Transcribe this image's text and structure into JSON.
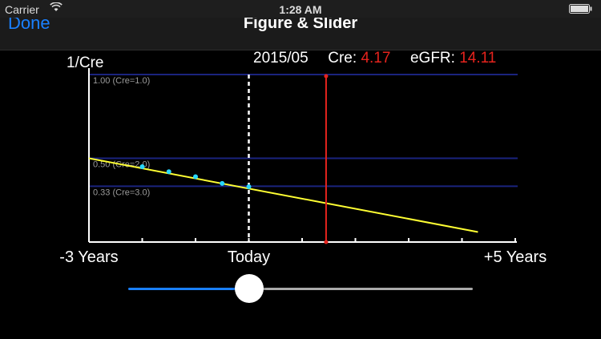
{
  "status_bar": {
    "carrier": "Carrier",
    "time": "1:28 AM"
  },
  "nav": {
    "back_label": "Done",
    "title": "Figure & Slider"
  },
  "readout": {
    "date": "2015/05",
    "cre_label": "Cre:",
    "cre_value": "4.17",
    "egfr_label": "eGFR:",
    "egfr_value": "14.11"
  },
  "slider": {
    "value": 0.35,
    "min_color": "#1a80ff",
    "max_color": "#aaaaaa"
  },
  "chart_data": {
    "type": "line",
    "ylabel": "1/Cre",
    "xlim": [
      -3,
      5
    ],
    "ylim": [
      0,
      1.0
    ],
    "x_tick_labels": [
      {
        "x": -3,
        "label": "-3 Years"
      },
      {
        "x": 0,
        "label": "Today"
      },
      {
        "x": 5,
        "label": "+5 Years"
      }
    ],
    "x_ticks": [
      -3,
      -2,
      -1,
      0,
      1,
      2,
      3,
      4,
      5
    ],
    "reference_lines": [
      {
        "y": 1.0,
        "label": "1.00 (Cre=1.0)"
      },
      {
        "y": 0.5,
        "label": "0.50 (Cre=2.0)"
      },
      {
        "y": 0.333,
        "label": "0.33 (Cre=3.0)"
      }
    ],
    "points": [
      {
        "x": -2.0,
        "y": 0.45
      },
      {
        "x": -1.5,
        "y": 0.42
      },
      {
        "x": -1.0,
        "y": 0.39
      },
      {
        "x": -0.5,
        "y": 0.35
      },
      {
        "x": 0.0,
        "y": 0.33
      }
    ],
    "trend_line": {
      "x1": -3,
      "y1": 0.5,
      "x2": 4.3,
      "y2": 0.06
    },
    "today_marker_x": 0,
    "selected_marker_x": 1.45,
    "colors": {
      "axis": "#ffffff",
      "reference": "#1a237e",
      "trend": "#ffff33",
      "points": "#28d7ff",
      "today": "#ffffff",
      "selected": "#e5231d"
    }
  }
}
